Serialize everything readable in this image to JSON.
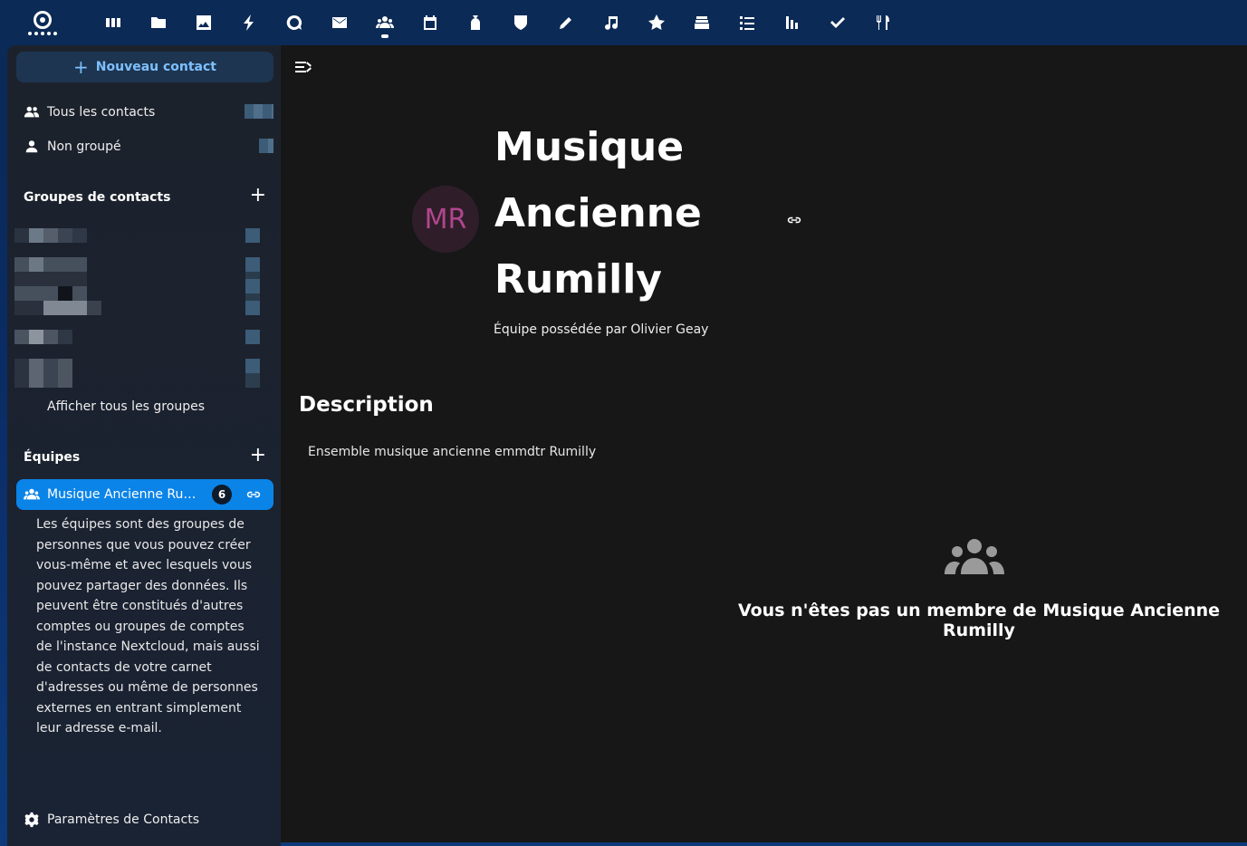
{
  "header": {
    "apps": [
      {
        "icon": "dashboard-icon"
      },
      {
        "icon": "files-icon"
      },
      {
        "icon": "photos-icon"
      },
      {
        "icon": "activity-icon"
      },
      {
        "icon": "talk-icon"
      },
      {
        "icon": "mail-icon"
      },
      {
        "icon": "contacts-icon",
        "active": true
      },
      {
        "icon": "calendar-icon"
      },
      {
        "icon": "money-bag-icon"
      },
      {
        "icon": "shield-icon"
      },
      {
        "icon": "pencil-icon"
      },
      {
        "icon": "music-icon"
      },
      {
        "icon": "star-icon"
      },
      {
        "icon": "deck-icon"
      },
      {
        "icon": "list-icon"
      },
      {
        "icon": "bar-chart-icon"
      },
      {
        "icon": "check-icon"
      },
      {
        "icon": "cookbook-icon"
      }
    ]
  },
  "sidebar": {
    "new_contact": "Nouveau contact",
    "all_contacts": "Tous les contacts",
    "ungrouped": "Non groupé",
    "groups_title": "Groupes de contacts",
    "show_all_groups": "Afficher tous les groupes",
    "teams_title": "Équipes",
    "team": {
      "name": "Musique Ancienne Rumilly",
      "count": "6"
    },
    "team_help": "Les équipes sont des groupes de personnes que vous pouvez créer vous-même et avec lesquels vous pouvez partager des données. Ils peuvent être constitués d'autres comptes ou groupes de comptes de l'instance Nextcloud, mais aussi de contacts de votre carnet d'adresses ou même de personnes externes en entrant simplement leur adresse e-mail.",
    "settings": "Paramètres de Contacts"
  },
  "main": {
    "avatar_initials": "MR",
    "title": "Musique Ancienne Rumilly",
    "owner": "Équipe possédée par Olivier Geay",
    "description_heading": "Description",
    "description": "Ensemble musique ancienne emmdtr Rumilly",
    "empty_message": "Vous n'êtes pas un membre de Musique Ancienne Rumilly"
  },
  "colors": {
    "accent": "#0b84e8",
    "avatar_text": "#b0468c",
    "main_bg": "#171717"
  }
}
